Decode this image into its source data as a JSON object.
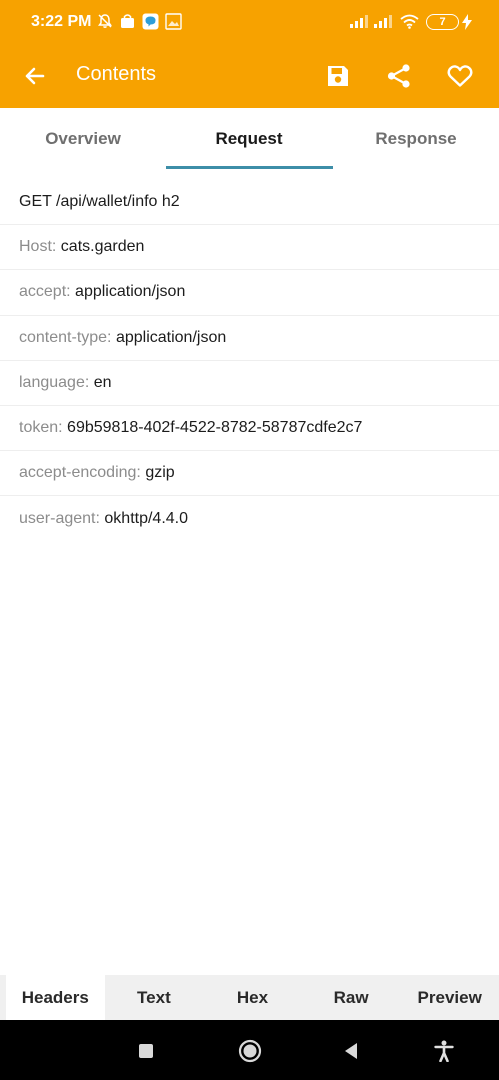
{
  "status_bar": {
    "time": "3:22 PM",
    "battery": "7",
    "left_icons": [
      "bell-off-icon",
      "shopping-bag-icon",
      "chat-app-icon",
      "image-icon"
    ],
    "right_icons": [
      "signal-icon",
      "signal-icon",
      "wifi-icon",
      "battery-icon",
      "charging-icon"
    ]
  },
  "toolbar": {
    "title": "Contents",
    "icons": [
      "back-arrow-icon",
      "save-icon",
      "share-icon",
      "heart-icon"
    ]
  },
  "tabs": {
    "items": [
      {
        "label": "Overview"
      },
      {
        "label": "Request"
      },
      {
        "label": "Response"
      }
    ],
    "active": "Request"
  },
  "request": {
    "line": "GET /api/wallet/info h2",
    "headers": [
      {
        "key": "Host:",
        "value": "cats.garden"
      },
      {
        "key": "accept:",
        "value": "application/json"
      },
      {
        "key": "content-type:",
        "value": "application/json"
      },
      {
        "key": "language:",
        "value": "en"
      },
      {
        "key": "token:",
        "value": "69b59818-402f-4522-8782-58787cdfe2c7"
      },
      {
        "key": "accept-encoding:",
        "value": "gzip"
      },
      {
        "key": "user-agent:",
        "value": "okhttp/4.4.0"
      }
    ]
  },
  "bottom_tabs": {
    "items": [
      {
        "label": "Headers"
      },
      {
        "label": "Text"
      },
      {
        "label": "Hex"
      },
      {
        "label": "Raw"
      },
      {
        "label": "Preview"
      }
    ],
    "active": "Headers"
  },
  "nav_bar": {
    "icons": [
      "recents-square-icon",
      "home-circle-icon",
      "back-triangle-icon",
      "accessibility-icon"
    ]
  },
  "colors": {
    "accent": "#f7a200",
    "tab_indicator": "#3d8ea8",
    "key_text": "#8c8c8c"
  }
}
